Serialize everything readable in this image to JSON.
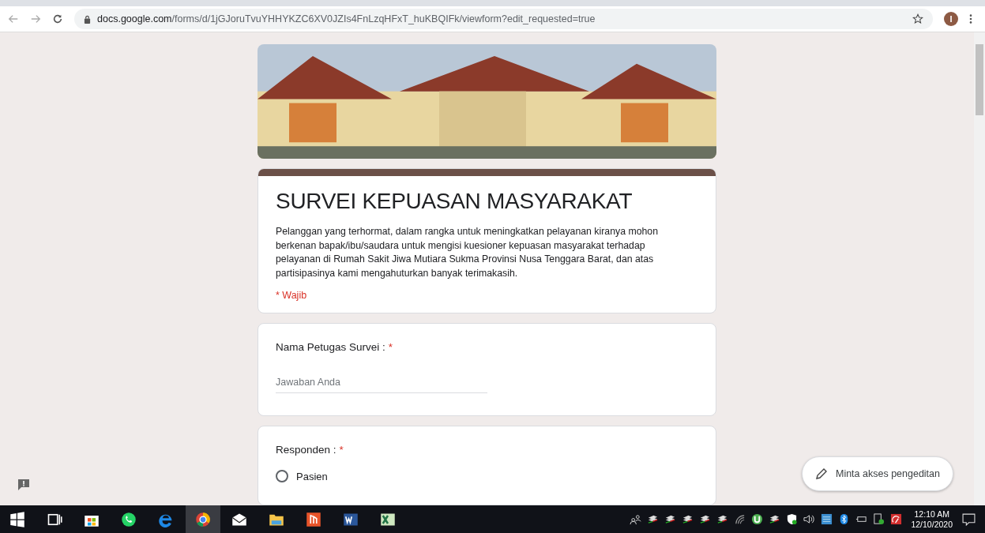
{
  "browser": {
    "url_host": "docs.google.com",
    "url_path": "/forms/d/1jGJoruTvuYHHYKZC6XV0JZIs4FnLzqHFxT_huKBQIFk/viewform?edit_requested=true",
    "avatar": "I"
  },
  "form": {
    "title": "SURVEI KEPUASAN MASYARAKAT",
    "description": "Pelanggan yang terhormat, dalam rangka untuk meningkatkan pelayanan kiranya mohon berkenan bapak/ibu/saudara untuk mengisi kuesioner kepuasan masyarakat terhadap pelayanan di Rumah Sakit Jiwa Mutiara Sukma Provinsi Nusa Tenggara Barat, dan  atas partisipasinya kami mengahuturkan banyak terimakasih.",
    "required_note": "* Wajib",
    "questions": [
      {
        "kind": "text",
        "label": "Nama Petugas Survei :",
        "required": true,
        "required_mark": "*",
        "placeholder": "Jawaban Anda"
      },
      {
        "kind": "radio",
        "label": "Responden :",
        "required": true,
        "required_mark": "*",
        "options": [
          {
            "label": "Pasien",
            "selected": false
          }
        ]
      }
    ]
  },
  "edit_request_button": "Minta akses pengeditan",
  "taskbar": {
    "time": "12:10 AM",
    "date": "12/10/2020"
  }
}
